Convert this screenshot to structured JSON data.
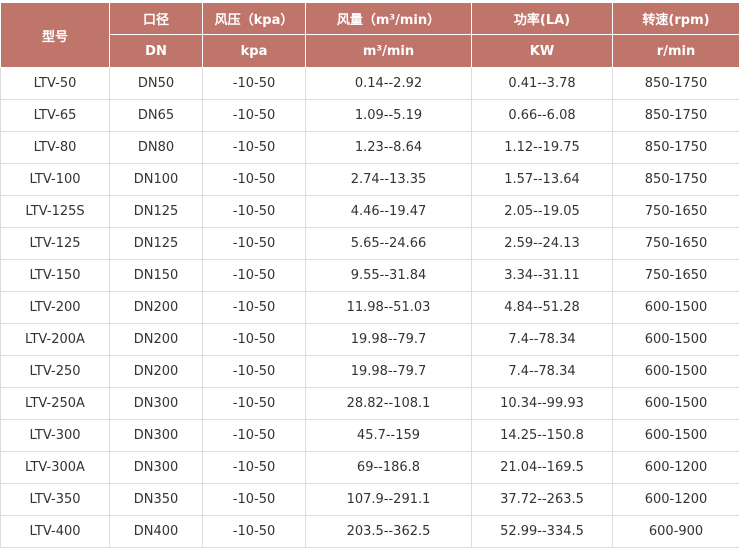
{
  "header": {
    "model": "型号",
    "diameter": "口径",
    "pressure": "风压（kpa）",
    "flow": "风量（m³/min）",
    "power": "功率(LA)",
    "speed": "转速(rpm)"
  },
  "units": {
    "diameter": "DN",
    "pressure": "kpa",
    "flow": "m³/min",
    "power": "KW",
    "speed": "r/min"
  },
  "rows": [
    {
      "model": "LTV-50",
      "dn": "DN50",
      "pressure": "-10-50",
      "flow": "0.14--2.92",
      "power": "0.41--3.78",
      "speed": "850-1750"
    },
    {
      "model": "LTV-65",
      "dn": "DN65",
      "pressure": "-10-50",
      "flow": "1.09--5.19",
      "power": "0.66--6.08",
      "speed": "850-1750"
    },
    {
      "model": "LTV-80",
      "dn": "DN80",
      "pressure": "-10-50",
      "flow": "1.23--8.64",
      "power": "1.12--19.75",
      "speed": "850-1750"
    },
    {
      "model": "LTV-100",
      "dn": "DN100",
      "pressure": "-10-50",
      "flow": "2.74--13.35",
      "power": "1.57--13.64",
      "speed": "850-1750"
    },
    {
      "model": "LTV-125S",
      "dn": "DN125",
      "pressure": "-10-50",
      "flow": "4.46--19.47",
      "power": "2.05--19.05",
      "speed": "750-1650"
    },
    {
      "model": "LTV-125",
      "dn": "DN125",
      "pressure": "-10-50",
      "flow": "5.65--24.66",
      "power": "2.59--24.13",
      "speed": "750-1650"
    },
    {
      "model": "LTV-150",
      "dn": "DN150",
      "pressure": "-10-50",
      "flow": "9.55--31.84",
      "power": "3.34--31.11",
      "speed": "750-1650"
    },
    {
      "model": "LTV-200",
      "dn": "DN200",
      "pressure": "-10-50",
      "flow": "11.98--51.03",
      "power": "4.84--51.28",
      "speed": "600-1500"
    },
    {
      "model": "LTV-200A",
      "dn": "DN200",
      "pressure": "-10-50",
      "flow": "19.98--79.7",
      "power": "7.4--78.34",
      "speed": "600-1500"
    },
    {
      "model": "LTV-250",
      "dn": "DN200",
      "pressure": "-10-50",
      "flow": "19.98--79.7",
      "power": "7.4--78.34",
      "speed": "600-1500"
    },
    {
      "model": "LTV-250A",
      "dn": "DN300",
      "pressure": "-10-50",
      "flow": "28.82--108.1",
      "power": "10.34--99.93",
      "speed": "600-1500"
    },
    {
      "model": "LTV-300",
      "dn": "DN300",
      "pressure": "-10-50",
      "flow": "45.7--159",
      "power": "14.25--150.8",
      "speed": "600-1500"
    },
    {
      "model": "LTV-300A",
      "dn": "DN300",
      "pressure": "-10-50",
      "flow": "69--186.8",
      "power": "21.04--169.5",
      "speed": "600-1200"
    },
    {
      "model": "LTV-350",
      "dn": "DN350",
      "pressure": "-10-50",
      "flow": "107.9--291.1",
      "power": "37.72--263.5",
      "speed": "600-1200"
    },
    {
      "model": "LTV-400",
      "dn": "DN400",
      "pressure": "-10-50",
      "flow": "203.5--362.5",
      "power": "52.99--334.5",
      "speed": "600-900"
    }
  ]
}
